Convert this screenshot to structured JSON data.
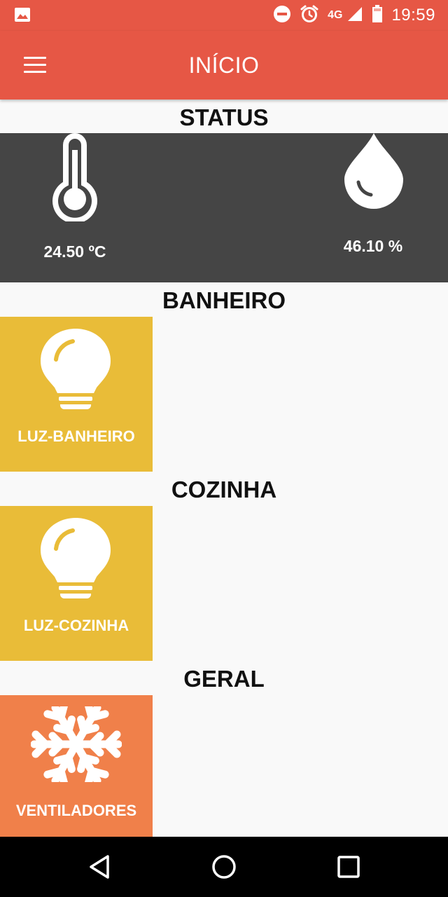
{
  "status_bar": {
    "time": "19:59",
    "network": "4G",
    "icons": [
      "image-notification-icon",
      "do-not-disturb-icon",
      "alarm-clock-icon",
      "signal-icon",
      "battery-icon"
    ]
  },
  "app_bar": {
    "title": "INÍCIO",
    "menu_icon": "hamburger-menu-icon"
  },
  "colors": {
    "accent": "#e65745",
    "status_panel": "#454545",
    "light_tile": "#e9bc38",
    "fan_tile": "#f0804a",
    "background": "#f9f9f9"
  },
  "status": {
    "title": "STATUS",
    "temperature": {
      "icon": "thermometer-icon",
      "value": "24.50 ºC"
    },
    "humidity": {
      "icon": "water-drop-icon",
      "value": "46.10 %"
    }
  },
  "sections": [
    {
      "title": "BANHEIRO",
      "tiles": [
        {
          "label": "LUZ-BANHEIRO",
          "icon": "lightbulb-icon"
        }
      ]
    },
    {
      "title": "COZINHA",
      "tiles": [
        {
          "label": "LUZ-COZINHA",
          "icon": "lightbulb-icon"
        }
      ]
    },
    {
      "title": "GERAL",
      "tiles": [
        {
          "label": "VENTILADORES",
          "icon": "snowflake-icon"
        }
      ]
    }
  ],
  "nav_bar": {
    "buttons": [
      "back-triangle-icon",
      "home-circle-icon",
      "recents-square-icon"
    ]
  }
}
